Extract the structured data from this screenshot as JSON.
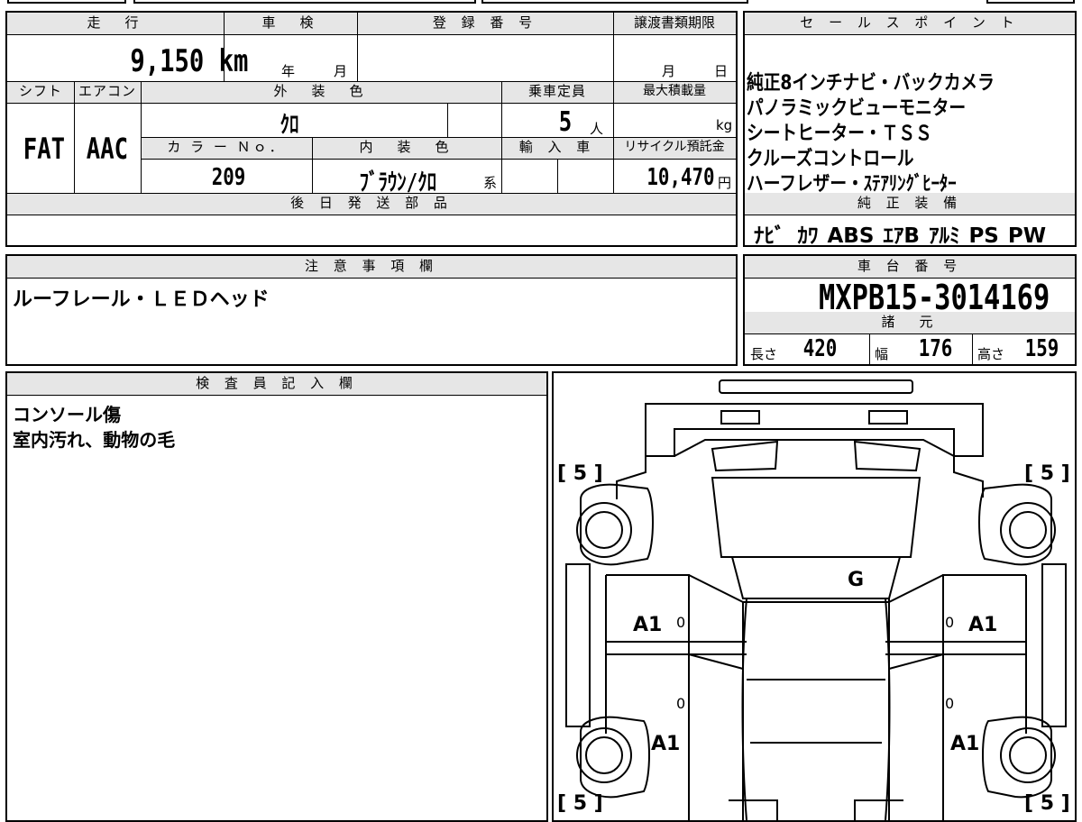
{
  "top_strip": {
    "partial_left": "■■■",
    "partial_mid": "■■■■"
  },
  "main": {
    "mileage_label": "走　行",
    "mileage_value": "9,150 km",
    "inspection_label": "車　検",
    "inspection_year": "年",
    "inspection_month": "月",
    "registration_label": "登 録 番 号",
    "registration_value": "",
    "transfer_label": "譲渡書類期限",
    "transfer_month": "月",
    "transfer_day": "日",
    "shift_label": "シフト",
    "shift_value": "FAT",
    "ac_label": "エアコン",
    "ac_value": "AAC",
    "exterior_label": "外　装　色",
    "exterior_value": "ｸﾛ",
    "capacity_label": "乗車定員",
    "capacity_value": "5",
    "capacity_unit": "人",
    "load_label": "最大積載量",
    "load_unit": "kg",
    "color_no_label": "カ ラ ー Ｎｏ．",
    "color_no_value": "209",
    "interior_label": "内　装　色",
    "interior_value": "ﾌﾞﾗｳﾝ/ｸﾛ",
    "interior_suffix": "系",
    "import_label": "輸 入 車",
    "recycle_label": "リサイクル預託金",
    "recycle_value": "10,470",
    "recycle_unit": "円",
    "later_parts_label": "後 日 発 送 部 品",
    "later_parts_value": ""
  },
  "sales": {
    "label": "セ ー ル ス ポ イ ン ト",
    "lines": [
      "純正8インチナビ・バックカメラ",
      "パノラミックビューモニター",
      "シートヒーター・ＴＳＳ",
      "クルーズコントロール",
      "ハーフレザー・ｽﾃｱﾘﾝｸﾞﾋｰﾀｰ"
    ]
  },
  "equipment": {
    "label": "純 正 装 備",
    "items": [
      "ﾅﾋﾞ",
      "ｶﾜ",
      "ABS",
      "ｴｱB",
      "ｱﾙﾐ",
      "PS",
      "PW"
    ]
  },
  "notes": {
    "label": "注 意 事 項 欄",
    "text": "ルーフレール・ＬＥＤヘッド"
  },
  "chassis": {
    "label": "車 台 番 号",
    "value": "MXPB15-3014169",
    "specs_label": "諸　元",
    "length_label": "長さ",
    "length_value": "420",
    "width_label": "幅",
    "width_value": "176",
    "height_label": "高さ",
    "height_value": "159"
  },
  "inspector": {
    "label": "検 査 員 記 入 欄",
    "lines": [
      "コンソール傷",
      "室内汚れ、動物の毛"
    ]
  },
  "diagram": {
    "tire_tl": "[ 5 ]",
    "tire_tr": "[ 5 ]",
    "tire_bl": "[ 5 ]",
    "tire_br": "[ 5 ]",
    "mark_g": "G",
    "mark_front_left": "A1",
    "mark_front_right": "A1",
    "mark_rear_left": "A1",
    "mark_rear_right": "A1",
    "zero_1": "0",
    "zero_2": "0",
    "zero_3": "0",
    "zero_4": "0"
  }
}
